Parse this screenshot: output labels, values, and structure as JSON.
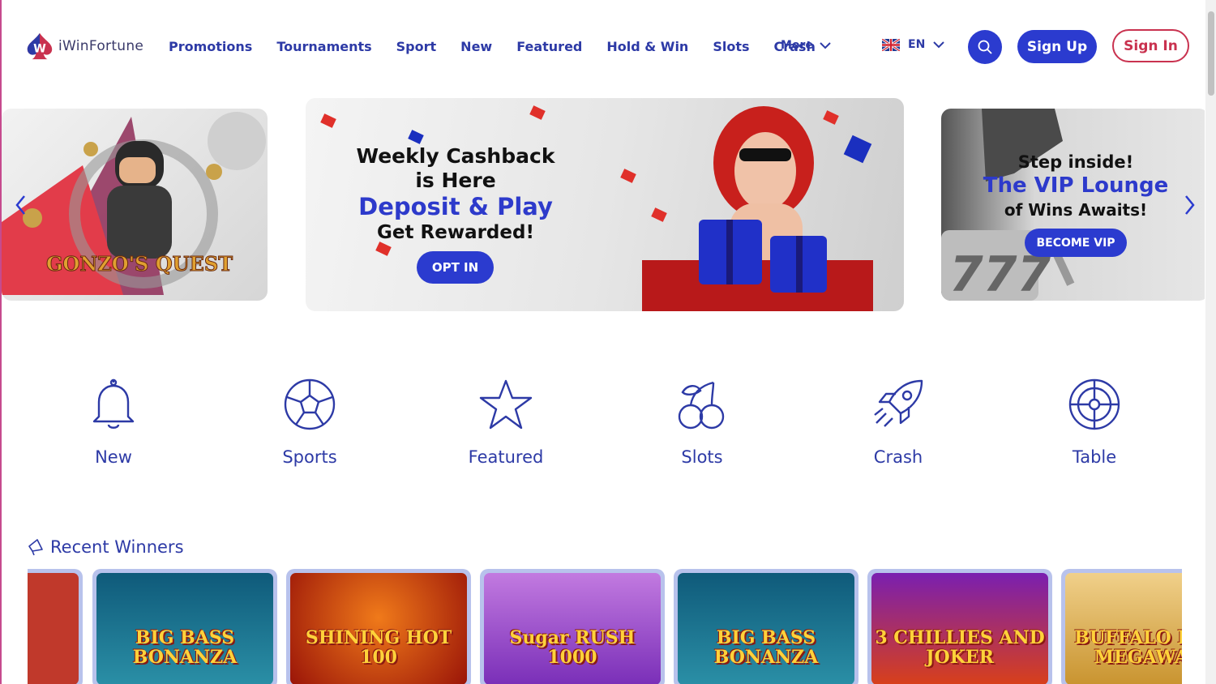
{
  "brand": {
    "name": "iWinFortune"
  },
  "nav": {
    "items": [
      {
        "label": "Promotions"
      },
      {
        "label": "Tournaments"
      },
      {
        "label": "Sport"
      },
      {
        "label": "New"
      },
      {
        "label": "Featured"
      },
      {
        "label": "Hold & Win"
      },
      {
        "label": "Slots"
      },
      {
        "label": "Crash"
      }
    ],
    "more_label": "More"
  },
  "language": {
    "code": "EN",
    "flag_icon": "uk-flag-icon"
  },
  "auth": {
    "signup_label": "Sign Up",
    "signin_label": "Sign In"
  },
  "banners": {
    "left": {
      "game_title": "GONZO'S QUEST"
    },
    "center": {
      "title": "Weekly Cashback is Here",
      "highlight": "Deposit & Play",
      "subtitle": "Get Rewarded!",
      "button": "OPT IN"
    },
    "right": {
      "line1": "Step inside!",
      "highlight": "The VIP Lounge",
      "line3": "of Wins Awaits!",
      "button": "BECOME VIP"
    }
  },
  "categories": [
    {
      "label": "New",
      "icon": "bell-icon"
    },
    {
      "label": "Sports",
      "icon": "soccer-ball-icon"
    },
    {
      "label": "Featured",
      "icon": "star-icon"
    },
    {
      "label": "Slots",
      "icon": "cherries-icon"
    },
    {
      "label": "Crash",
      "icon": "rocket-icon"
    },
    {
      "label": "Table",
      "icon": "roulette-icon"
    }
  ],
  "recent_winners": {
    "title": "Recent Winners",
    "games": [
      {
        "name": "",
        "bg": "#c0392b"
      },
      {
        "name": "BIG BASS BONANZA",
        "bg": "#1b6f8a"
      },
      {
        "name": "SHINING HOT 100",
        "bg": "#b3200f"
      },
      {
        "name": "Sugar RUSH 1000",
        "bg": "#8a3fc4"
      },
      {
        "name": "BIG BASS BONANZA",
        "bg": "#1b6f8a"
      },
      {
        "name": "3 CHILLIES AND JOKER",
        "bg": "#6e1fa0"
      },
      {
        "name": "BUFFALO KING MEGAWAYS",
        "bg": "#d9a64a"
      }
    ]
  },
  "colors": {
    "primary": "#2b3bcf",
    "accent_red": "#c9324f",
    "text_blue": "#2d3aa6"
  }
}
